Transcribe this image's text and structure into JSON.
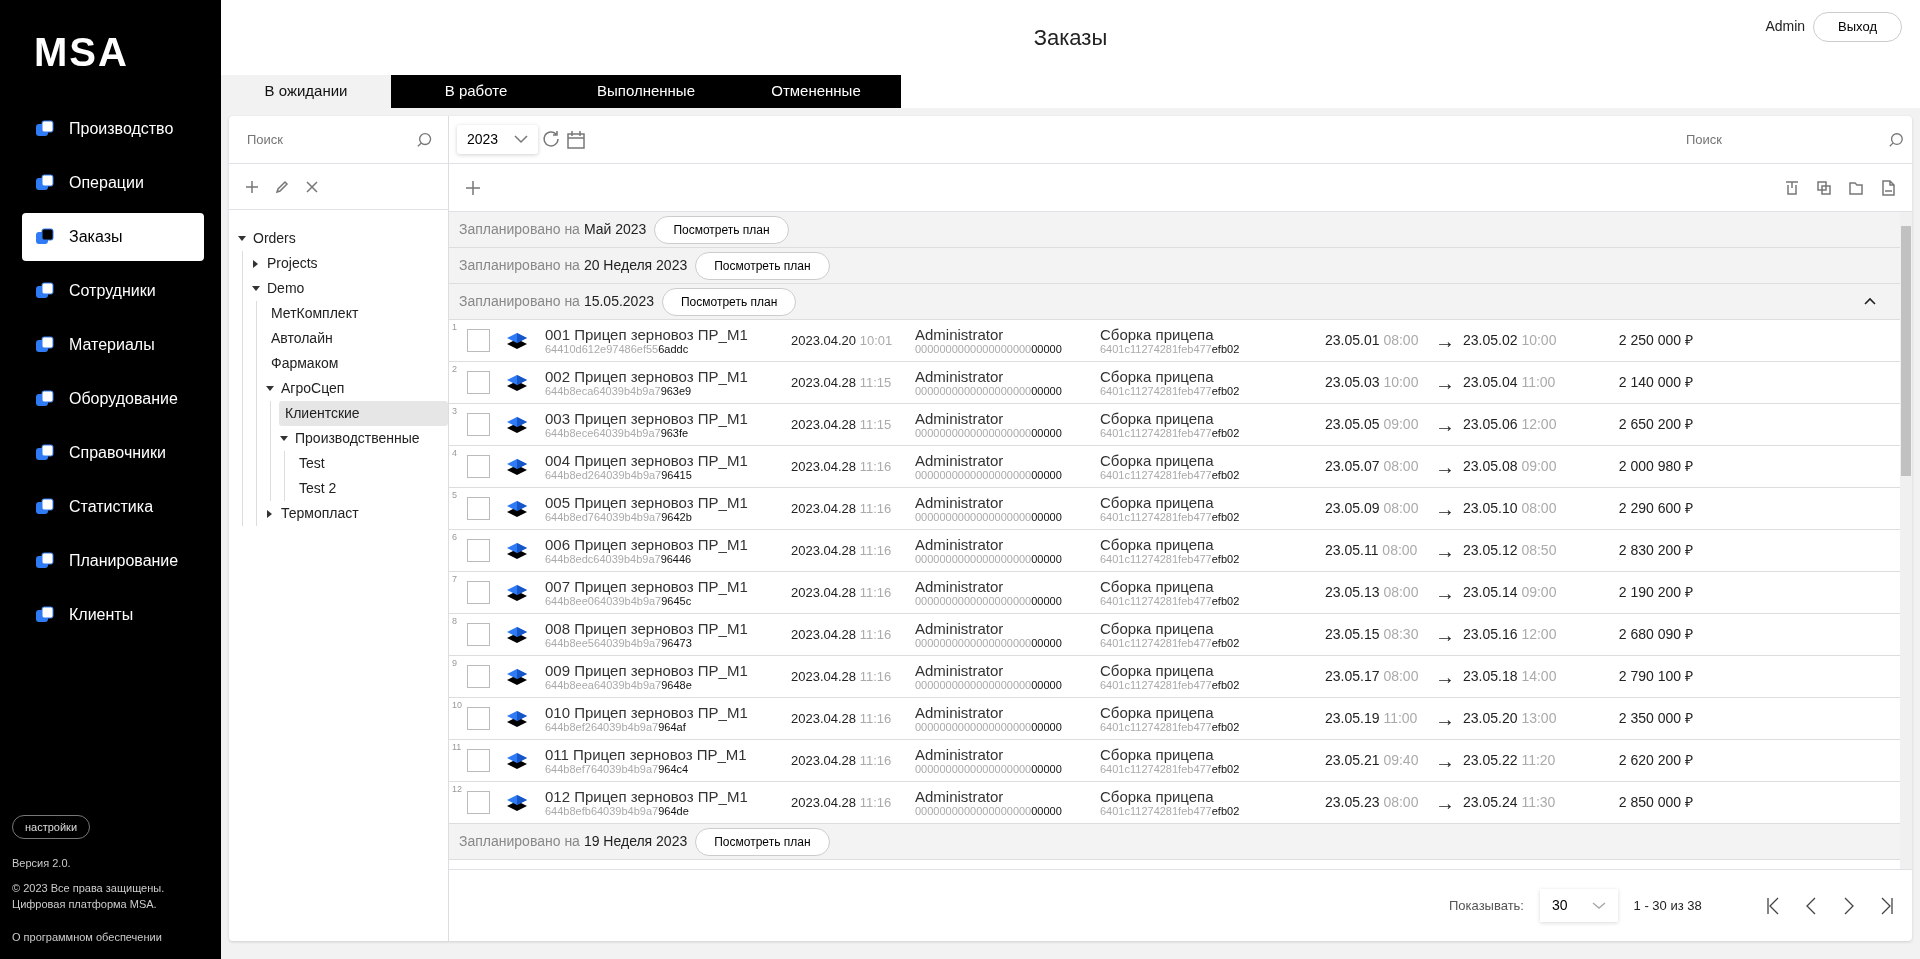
{
  "logo": "MSA",
  "nav": [
    {
      "label": "Производство",
      "selected": false
    },
    {
      "label": "Операции",
      "selected": false
    },
    {
      "label": "Заказы",
      "selected": true
    },
    {
      "label": "Сотрудники",
      "selected": false
    },
    {
      "label": "Материалы",
      "selected": false
    },
    {
      "label": "Оборудование",
      "selected": false
    },
    {
      "label": "Справочники",
      "selected": false
    },
    {
      "label": "Статистика",
      "selected": false
    },
    {
      "label": "Планирование",
      "selected": false
    },
    {
      "label": "Клиенты",
      "selected": false
    }
  ],
  "sidebar_footer": {
    "settings": "настройки",
    "version": "Версия 2.0.",
    "copyright": [
      "© 2023 Все права защищены.",
      "Цифровая платформа MSA."
    ],
    "about": "О программном обеспечении"
  },
  "page_title": "Заказы",
  "user": {
    "name": "Admin",
    "logout": "Выход"
  },
  "tabs": [
    {
      "label": "В ожидании",
      "selected": true
    },
    {
      "label": "В работе",
      "selected": false
    },
    {
      "label": "Выполненные",
      "selected": false
    },
    {
      "label": "Отмененные",
      "selected": false
    }
  ],
  "tree_search": {
    "placeholder": "Поиск"
  },
  "tree": [
    {
      "label": "Orders",
      "expanded": true,
      "selected": false,
      "children": [
        {
          "label": "Projects",
          "expanded": false,
          "selected": false
        },
        {
          "label": "Demo",
          "expanded": true,
          "selected": false,
          "children": [
            {
              "label": "МетКомплект",
              "selected": false
            },
            {
              "label": "Автолайн",
              "selected": false
            },
            {
              "label": "Фармаком",
              "selected": false
            },
            {
              "label": "АгроСцеп",
              "expanded": true,
              "selected": false,
              "children": [
                {
                  "label": "Клиентские",
                  "selected": true
                },
                {
                  "label": "Производственные",
                  "expanded": true,
                  "selected": false,
                  "children": [
                    {
                      "label": "Test",
                      "selected": false
                    },
                    {
                      "label": "Test 2",
                      "selected": false
                    }
                  ]
                }
              ]
            },
            {
              "label": "Термопласт",
              "expanded": false,
              "selected": false
            }
          ]
        }
      ]
    }
  ],
  "year_select": {
    "value": "2023"
  },
  "table_search": {
    "placeholder": "Поиск"
  },
  "groups": [
    {
      "prefix": "Запланировано на",
      "period": "Май 2023",
      "button": "Посмотреть план",
      "expanded": false
    },
    {
      "prefix": "Запланировано на",
      "period": "20 Неделя 2023",
      "button": "Посмотреть план",
      "expanded": false
    },
    {
      "prefix": "Запланировано на",
      "period": "15.05.2023",
      "button": "Посмотреть план",
      "expanded": true,
      "rows": [
        {
          "num": "1",
          "checked": false,
          "name": "001 Прицеп зерновоз ПР_М1",
          "id": "64410d612e97486ef556addc",
          "date": "2023.04.20",
          "time": "10:01",
          "user": "Administrator",
          "user_id": "000000000000000000000000",
          "operation": "Сборка прицепа",
          "op_id": "6401c11274281feb477efb02",
          "start_date": "23.05.01",
          "start_time": "08:00",
          "end_date": "23.05.02",
          "end_time": "10:00",
          "price": "2 250 000 ₽"
        },
        {
          "num": "2",
          "checked": false,
          "name": "002 Прицеп зерновоз ПР_М1",
          "id": "644b8eca64039b4b9a7963e9",
          "date": "2023.04.28",
          "time": "11:15",
          "user": "Administrator",
          "user_id": "000000000000000000000000",
          "operation": "Сборка прицепа",
          "op_id": "6401c11274281feb477efb02",
          "start_date": "23.05.03",
          "start_time": "10:00",
          "end_date": "23.05.04",
          "end_time": "11:00",
          "price": "2 140 000 ₽"
        },
        {
          "num": "3",
          "checked": false,
          "name": "003 Прицеп зерновоз ПР_М1",
          "id": "644b8ece64039b4b9a7963fe",
          "date": "2023.04.28",
          "time": "11:15",
          "user": "Administrator",
          "user_id": "000000000000000000000000",
          "operation": "Сборка прицепа",
          "op_id": "6401c11274281feb477efb02",
          "start_date": "23.05.05",
          "start_time": "09:00",
          "end_date": "23.05.06",
          "end_time": "12:00",
          "price": "2 650 200 ₽"
        },
        {
          "num": "4",
          "checked": false,
          "name": "004 Прицеп зерновоз ПР_М1",
          "id": "644b8ed264039b4b9a796415",
          "date": "2023.04.28",
          "time": "11:16",
          "user": "Administrator",
          "user_id": "000000000000000000000000",
          "operation": "Сборка прицепа",
          "op_id": "6401c11274281feb477efb02",
          "start_date": "23.05.07",
          "start_time": "08:00",
          "end_date": "23.05.08",
          "end_time": "09:00",
          "price": "2 000 980 ₽"
        },
        {
          "num": "5",
          "checked": false,
          "name": "005 Прицеп зерновоз ПР_М1",
          "id": "644b8ed764039b4b9a79642b",
          "date": "2023.04.28",
          "time": "11:16",
          "user": "Administrator",
          "user_id": "000000000000000000000000",
          "operation": "Сборка прицепа",
          "op_id": "6401c11274281feb477efb02",
          "start_date": "23.05.09",
          "start_time": "08:00",
          "end_date": "23.05.10",
          "end_time": "08:00",
          "price": "2 290 600 ₽"
        },
        {
          "num": "6",
          "checked": false,
          "name": "006 Прицеп зерновоз ПР_М1",
          "id": "644b8edc64039b4b9a796446",
          "date": "2023.04.28",
          "time": "11:16",
          "user": "Administrator",
          "user_id": "000000000000000000000000",
          "operation": "Сборка прицепа",
          "op_id": "6401c11274281feb477efb02",
          "start_date": "23.05.11",
          "start_time": "08:00",
          "end_date": "23.05.12",
          "end_time": "08:50",
          "price": "2 830 200 ₽"
        },
        {
          "num": "7",
          "checked": false,
          "name": "007 Прицеп зерновоз ПР_М1",
          "id": "644b8ee064039b4b9a79645c",
          "date": "2023.04.28",
          "time": "11:16",
          "user": "Administrator",
          "user_id": "000000000000000000000000",
          "operation": "Сборка прицепа",
          "op_id": "6401c11274281feb477efb02",
          "start_date": "23.05.13",
          "start_time": "08:00",
          "end_date": "23.05.14",
          "end_time": "09:00",
          "price": "2 190 200 ₽"
        },
        {
          "num": "8",
          "checked": false,
          "name": "008 Прицеп зерновоз ПР_М1",
          "id": "644b8ee564039b4b9a796473",
          "date": "2023.04.28",
          "time": "11:16",
          "user": "Administrator",
          "user_id": "000000000000000000000000",
          "operation": "Сборка прицепа",
          "op_id": "6401c11274281feb477efb02",
          "start_date": "23.05.15",
          "start_time": "08:30",
          "end_date": "23.05.16",
          "end_time": "12:00",
          "price": "2 680 090 ₽"
        },
        {
          "num": "9",
          "checked": false,
          "name": "009 Прицеп зерновоз ПР_М1",
          "id": "644b8eea64039b4b9a79648e",
          "date": "2023.04.28",
          "time": "11:16",
          "user": "Administrator",
          "user_id": "000000000000000000000000",
          "operation": "Сборка прицепа",
          "op_id": "6401c11274281feb477efb02",
          "start_date": "23.05.17",
          "start_time": "08:00",
          "end_date": "23.05.18",
          "end_time": "14:00",
          "price": "2 790 100 ₽"
        },
        {
          "num": "10",
          "checked": false,
          "name": "010 Прицеп зерновоз ПР_М1",
          "id": "644b8ef264039b4b9a7964af",
          "date": "2023.04.28",
          "time": "11:16",
          "user": "Administrator",
          "user_id": "000000000000000000000000",
          "operation": "Сборка прицепа",
          "op_id": "6401c11274281feb477efb02",
          "start_date": "23.05.19",
          "start_time": "11:00",
          "end_date": "23.05.20",
          "end_time": "13:00",
          "price": "2 350 000 ₽"
        },
        {
          "num": "11",
          "checked": false,
          "name": "011 Прицеп зерновоз ПР_М1",
          "id": "644b8ef764039b4b9a7964c4",
          "date": "2023.04.28",
          "time": "11:16",
          "user": "Administrator",
          "user_id": "000000000000000000000000",
          "operation": "Сборка прицепа",
          "op_id": "6401c11274281feb477efb02",
          "start_date": "23.05.21",
          "start_time": "09:40",
          "end_date": "23.05.22",
          "end_time": "11:20",
          "price": "2 620 200 ₽"
        },
        {
          "num": "12",
          "checked": false,
          "name": "012 Прицеп зерновоз ПР_М1",
          "id": "644b8efb64039b4b9a7964de",
          "date": "2023.04.28",
          "time": "11:16",
          "user": "Administrator",
          "user_id": "000000000000000000000000",
          "operation": "Сборка прицепа",
          "op_id": "6401c11274281feb477efb02",
          "start_date": "23.05.23",
          "start_time": "08:00",
          "end_date": "23.05.24",
          "end_time": "11:30",
          "price": "2 850 000 ₽"
        }
      ]
    },
    {
      "prefix": "Запланировано на",
      "period": "19 Неделя 2023",
      "button": "Посмотреть план",
      "expanded": false
    }
  ],
  "arrow": "→",
  "pagination": {
    "label": "Показывать:",
    "page_size": "30",
    "range": "1 - 30 из 38"
  }
}
